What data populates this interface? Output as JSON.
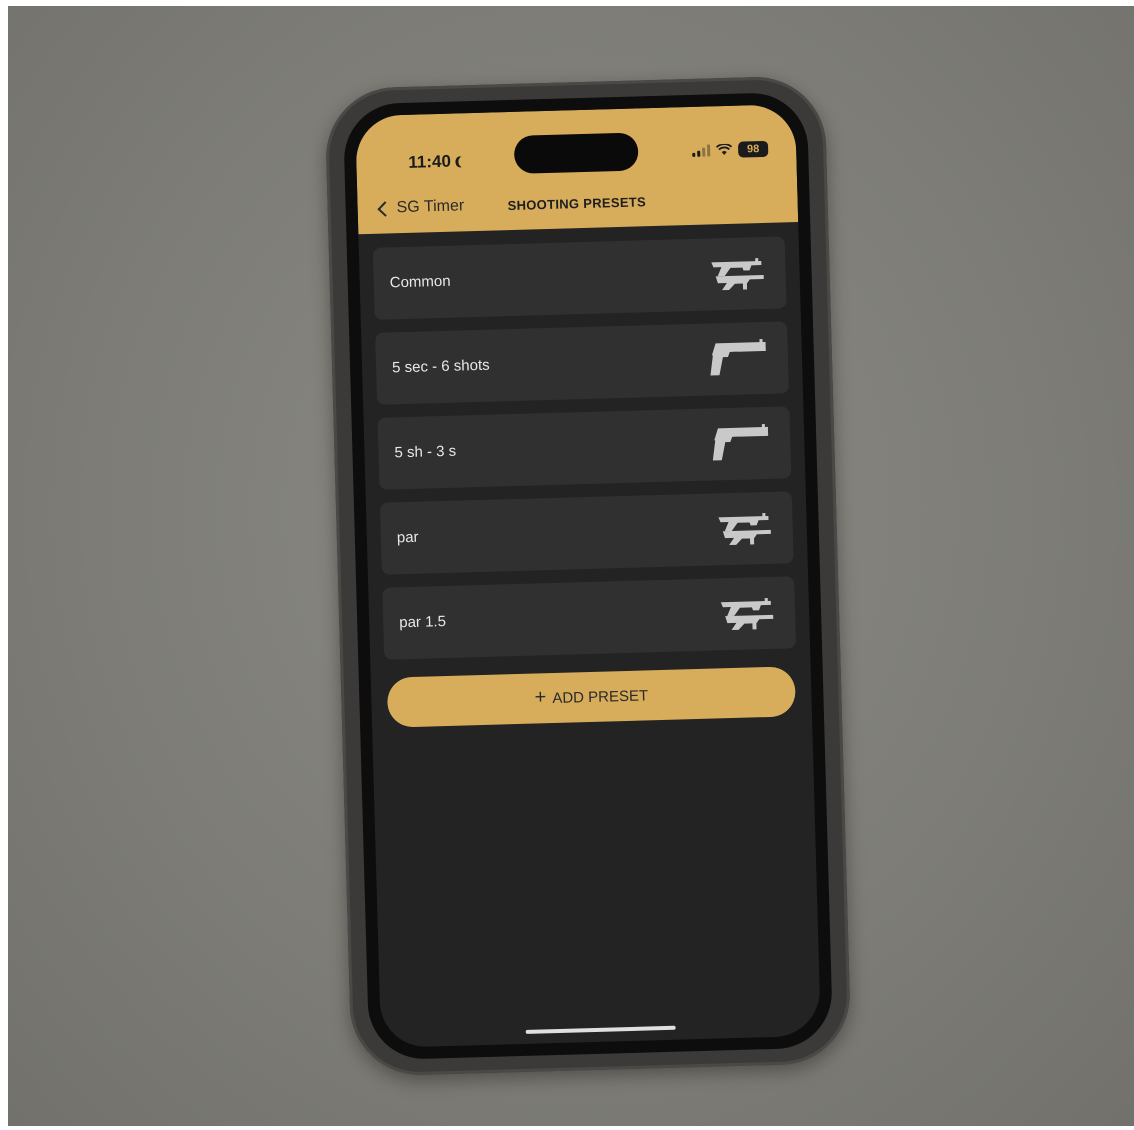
{
  "status_bar": {
    "time": "11:40",
    "battery": "98"
  },
  "nav": {
    "back_label": "SG Timer",
    "title": "SHOOTING PRESETS"
  },
  "presets": [
    {
      "label": "Common",
      "icon": "rifle-icon"
    },
    {
      "label": "5 sec - 6 shots",
      "icon": "pistol-icon"
    },
    {
      "label": "5 sh - 3 s",
      "icon": "pistol-icon"
    },
    {
      "label": "par",
      "icon": "rifle-icon"
    },
    {
      "label": "par 1.5",
      "icon": "rifle-icon"
    }
  ],
  "add_preset": {
    "label": "ADD PRESET",
    "icon": "plus-icon"
  },
  "colors": {
    "accent": "#d7ad5c",
    "background": "#232323",
    "row": "#303030",
    "background_surface": "#7d7c76"
  }
}
